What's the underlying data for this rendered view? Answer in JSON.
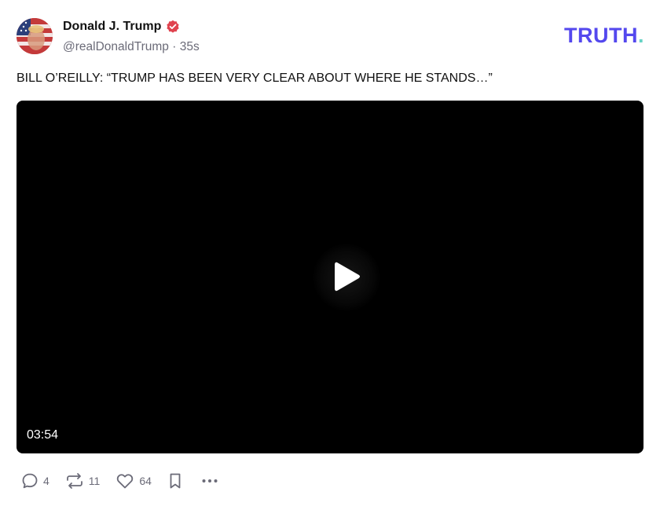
{
  "post": {
    "author_name": "Donald J. Trump",
    "handle": "@realDonaldTrump",
    "separator": "·",
    "time_ago": "35s",
    "text": "BILL O’REILLY: “TRUMP HAS BEEN VERY CLEAR ABOUT WHERE HE STANDS…”"
  },
  "brand": {
    "word": "TRUTH",
    "dot": ".",
    "colors": {
      "primary": "#5448ee",
      "accent": "#65d3c4"
    }
  },
  "video": {
    "duration": "03:54",
    "play_icon": "play-icon"
  },
  "actions": {
    "replies": "4",
    "retruths": "11",
    "likes": "64",
    "icons": [
      "reply-icon",
      "retruth-icon",
      "like-icon",
      "bookmark-icon",
      "more-icon"
    ]
  },
  "colors": {
    "verified_badge": "#e0434f",
    "muted_text": "#6b6b78"
  }
}
